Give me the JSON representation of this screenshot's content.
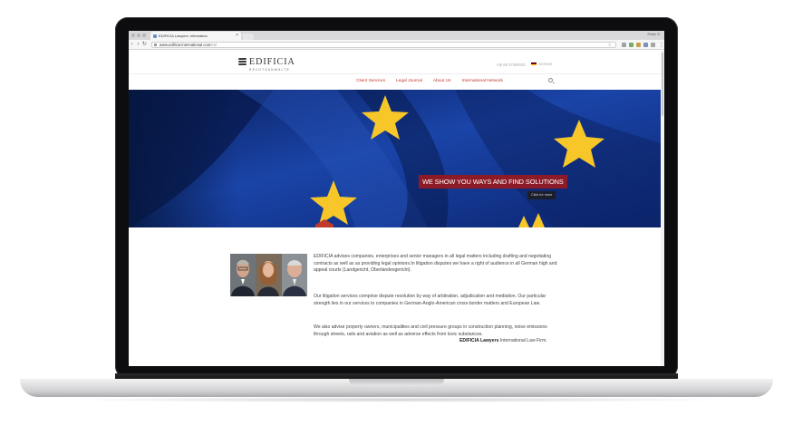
{
  "browser": {
    "tab_title": "EDIFICIA Lawyers: Internation",
    "tab_close": "×",
    "profile": "Peter S.",
    "url_main": "www.edificia-international.com",
    "url_path": "/en/",
    "nav_back": "‹",
    "nav_forward": "›",
    "nav_reload": "↻",
    "bookmark_star": "☆",
    "menu_glyph": "⋮"
  },
  "site": {
    "brand": {
      "name": "EDIFICIA",
      "subtitle": "RECHTSANWÄLTE"
    },
    "phone": "+49 89 37099230",
    "language": "German",
    "flag_colors": [
      "#000000",
      "#dd0000",
      "#ffce00"
    ],
    "nav": [
      {
        "label": "Client Services"
      },
      {
        "label": "Legal Journal"
      },
      {
        "label": "About Us"
      },
      {
        "label": "International Network"
      }
    ],
    "hero": {
      "slogan": "WE SHOW YOU WAYS AND FIND SOLUTIONS",
      "cta": "Click for more"
    },
    "content": {
      "paragraph_1": "EDIFICIA advises companies, enterprises and senior managers in all legal matters including drafting and negotiating contracts as well as as providing legal opinions.In litigation disputes we have a right of audience in all German high and appeal courts (Landgericht, Oberlandesgericht).",
      "paragraph_2": "Our litigation services comprise dispute resolution by way of arbitration, adjudication and mediation. Our particular strength lies in our services to companies in German-Anglo-American cross-border matters and European Law.",
      "paragraph_3": "We also advise property owners, municipalities and civil pressure groups in construction planning, noise emissions through streets, rails and aviation as well as adverse effects from toxic substances.",
      "signature_bold": "EDIFICIA Lawyers",
      "signature_rest": " International Law Firm."
    },
    "colors": {
      "accent": "#c0392b",
      "slogan_bg": "#8c1b27",
      "eu_blue": "#11307f",
      "eu_star": "#f7c72a"
    }
  }
}
